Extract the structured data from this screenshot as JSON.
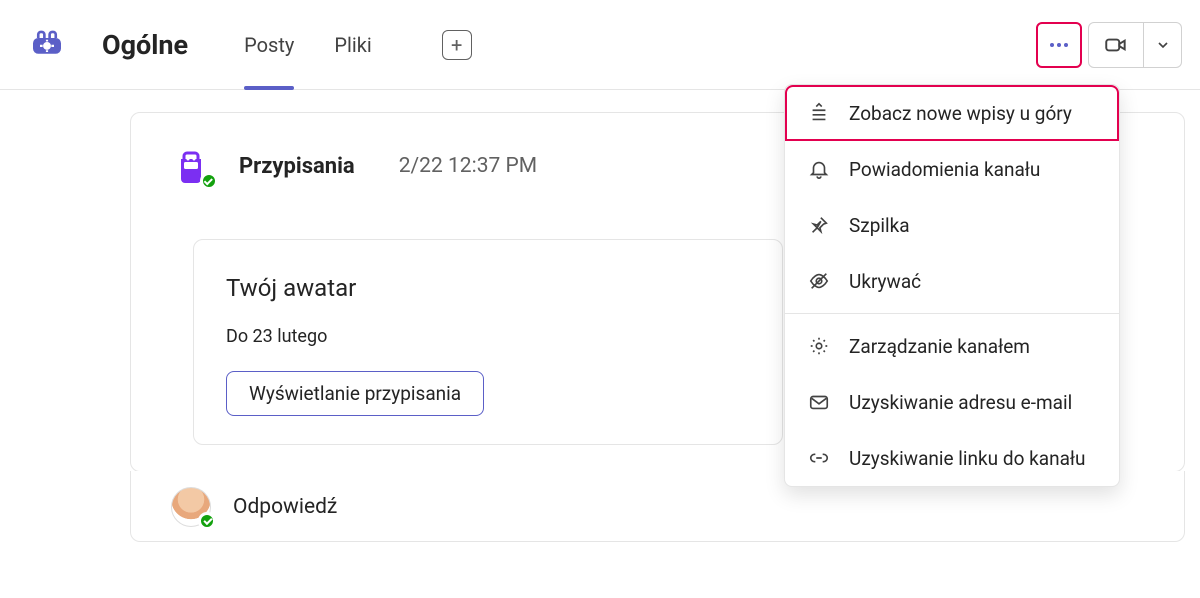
{
  "header": {
    "channel_name": "Ogólne",
    "tabs": [
      {
        "label": "Posty",
        "active": true
      },
      {
        "label": "Pliki",
        "active": false
      }
    ]
  },
  "post": {
    "author": "Przypisania",
    "timestamp": "2/22 12:37 PM",
    "card": {
      "title": "Twój awatar",
      "subtitle": "Do 23 lutego",
      "button": "Wyświetlanie przypisania"
    }
  },
  "reply": {
    "label": "Odpowiedź"
  },
  "menu": {
    "items": [
      {
        "icon": "sort-newest",
        "label": "Zobacz nowe wpisy u góry",
        "highlight": true
      },
      {
        "icon": "bell",
        "label": "Powiadomienia kanału"
      },
      {
        "icon": "pin",
        "label": "Szpilka"
      },
      {
        "icon": "hide",
        "label": "Ukrywać"
      },
      {
        "sep": true
      },
      {
        "icon": "gear",
        "label": "Zarządzanie kanałem"
      },
      {
        "icon": "mail",
        "label": "Uzyskiwanie adresu e-mail"
      },
      {
        "icon": "link",
        "label": "Uzyskiwanie linku do kanału"
      }
    ]
  },
  "colors": {
    "accent": "#5b5fc7",
    "highlight": "#e3004f"
  }
}
